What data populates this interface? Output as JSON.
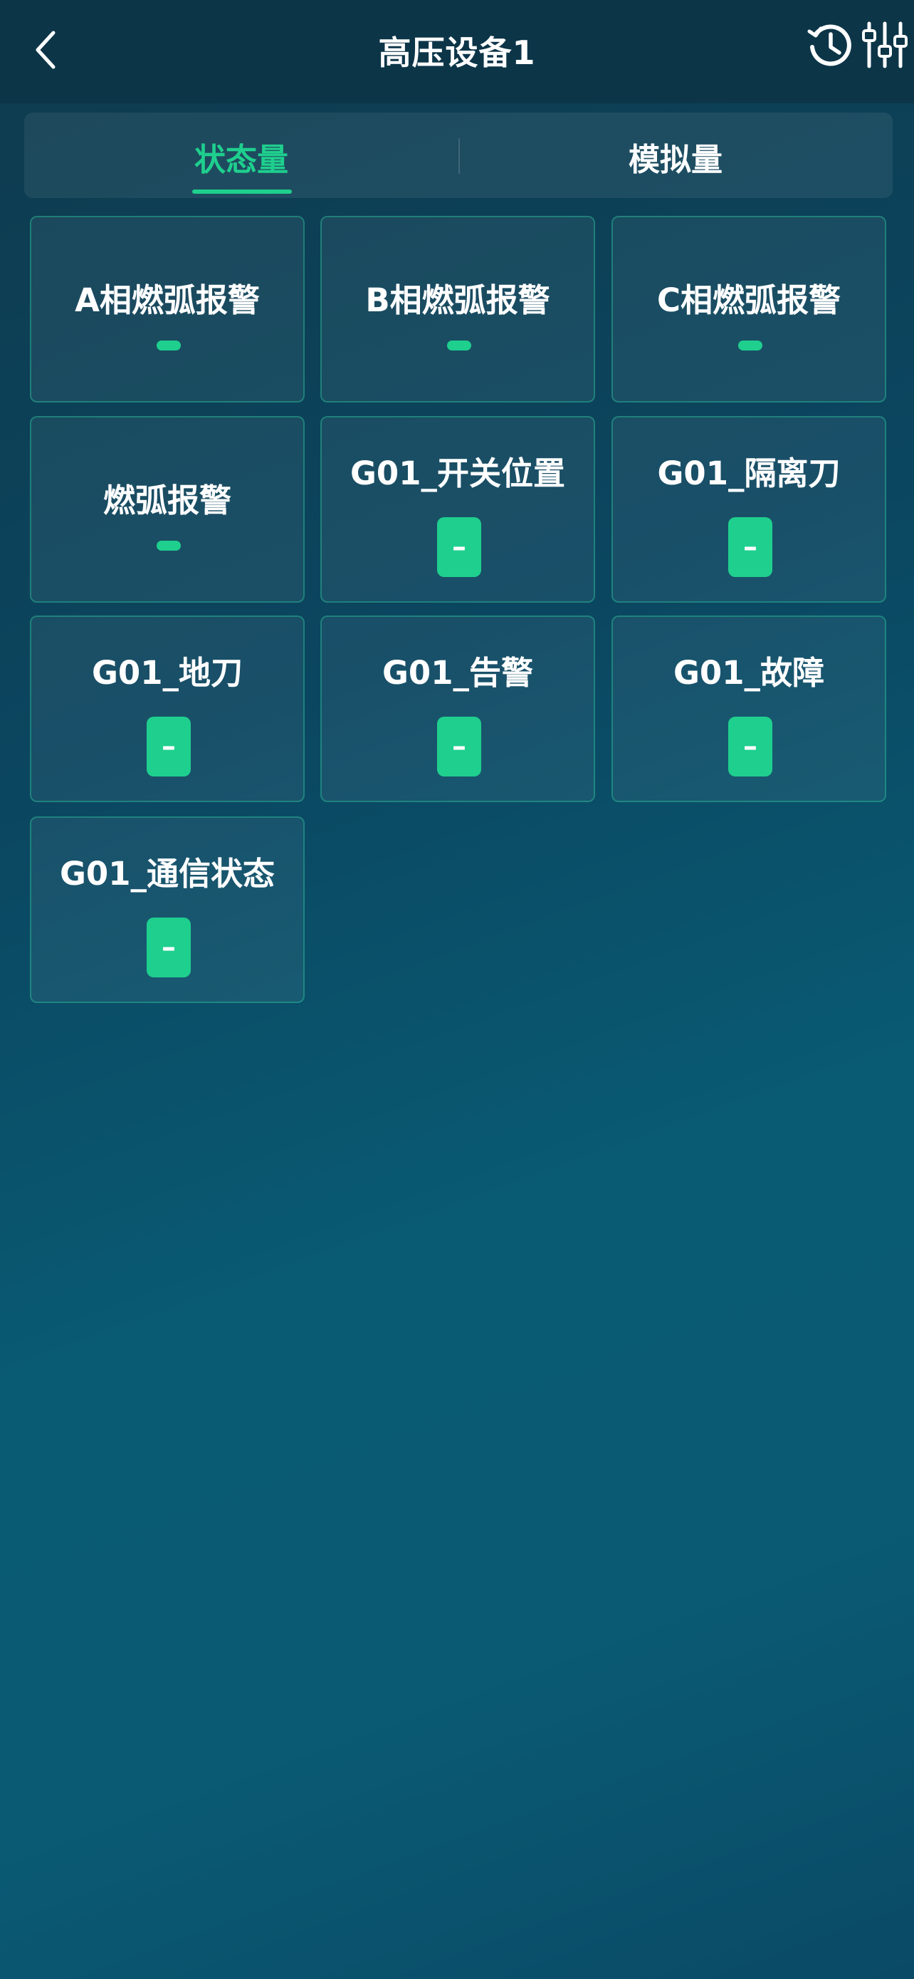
{
  "header": {
    "title": "高压设备1",
    "back_icon": "chevron-left-icon",
    "history_icon": "history-clock-icon",
    "filter_icon": "sliders-icon"
  },
  "tabs": [
    {
      "label": "状态量",
      "active": true
    },
    {
      "label": "模拟量",
      "active": false
    }
  ],
  "status_items": [
    {
      "title": "A相燃弧报警",
      "indicator": "bar",
      "value": ""
    },
    {
      "title": "B相燃弧报警",
      "indicator": "bar",
      "value": ""
    },
    {
      "title": "C相燃弧报警",
      "indicator": "bar",
      "value": ""
    },
    {
      "title": "燃弧报警",
      "indicator": "bar",
      "value": ""
    },
    {
      "title": "G01_开关位置",
      "indicator": "box",
      "value": "–"
    },
    {
      "title": "G01_隔离刀",
      "indicator": "box",
      "value": "–"
    },
    {
      "title": "G01_地刀",
      "indicator": "box",
      "value": "–"
    },
    {
      "title": "G01_告警",
      "indicator": "box",
      "value": "–"
    },
    {
      "title": "G01_故障",
      "indicator": "box",
      "value": "–"
    },
    {
      "title": "G01_通信状态",
      "indicator": "box",
      "value": "–"
    }
  ],
  "colors": {
    "accent": "#1fcf8e",
    "header_bg": "#0c3548",
    "card_border": "#28be96"
  }
}
